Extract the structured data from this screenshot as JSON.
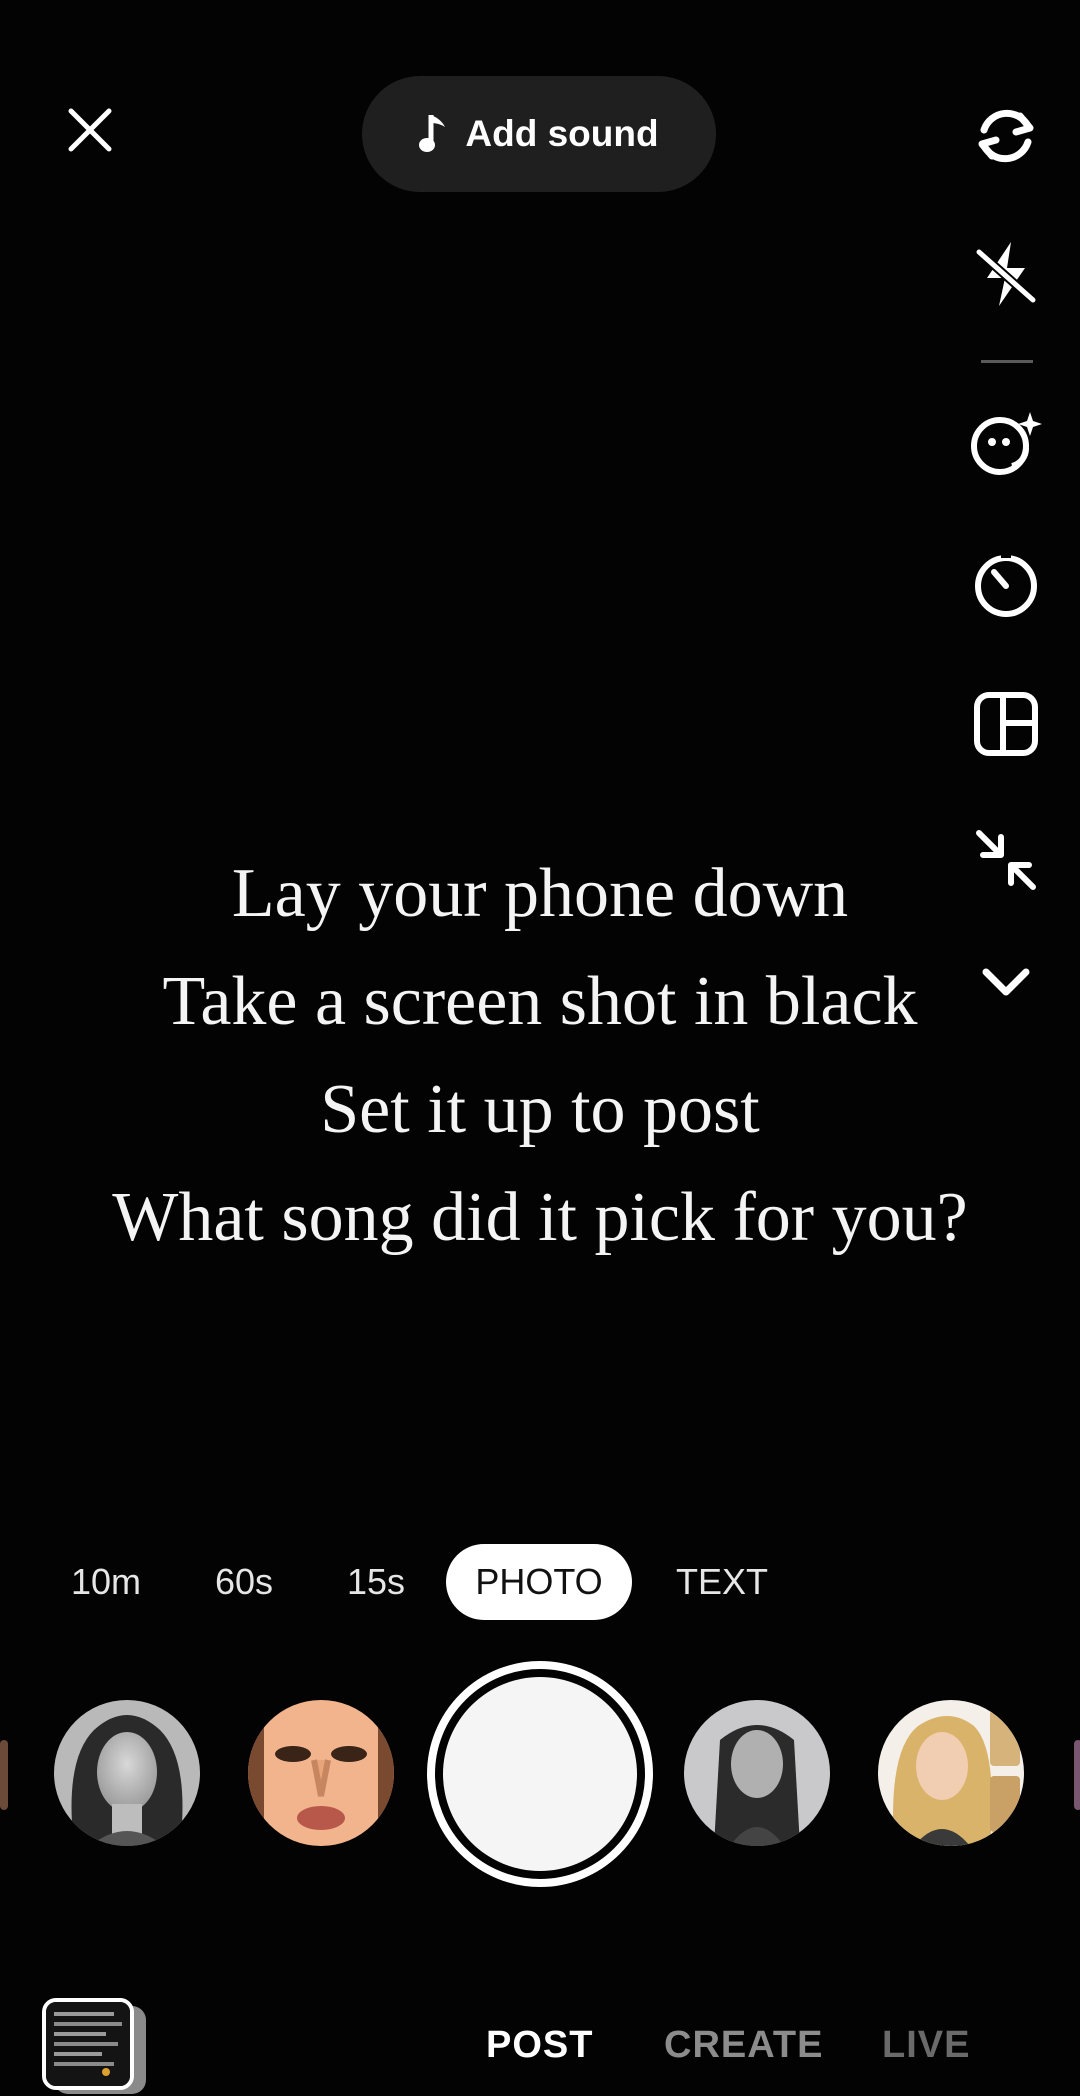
{
  "header": {
    "close_icon": "close-icon",
    "add_sound": {
      "icon": "music-note-icon",
      "label": "Add sound"
    }
  },
  "tools": [
    {
      "name": "flip-camera",
      "icon": "flip-camera-icon"
    },
    {
      "name": "flash",
      "icon": "flash-off-icon"
    },
    {
      "name": "effects",
      "icon": "face-sparkle-icon"
    },
    {
      "name": "timer",
      "icon": "timer-icon"
    },
    {
      "name": "layout",
      "icon": "layout-grid-icon"
    },
    {
      "name": "fit",
      "icon": "collapse-arrows-icon"
    },
    {
      "name": "more",
      "icon": "chevron-down-icon"
    }
  ],
  "overlay_text": {
    "line1": "Lay your phone down",
    "line2": "Take a screen shot in black",
    "line3": "Set it up to post",
    "line4": "What song did it pick for you?"
  },
  "modes": {
    "items": [
      "10m",
      "60s",
      "15s",
      "PHOTO",
      "TEXT"
    ],
    "selected": "PHOTO"
  },
  "effects_row": [
    {
      "name": "effect-portrait-1"
    },
    {
      "name": "effect-portrait-2"
    },
    {
      "name": "effect-portrait-3"
    },
    {
      "name": "effect-portrait-4"
    }
  ],
  "bottom_nav": {
    "post": "POST",
    "create": "CREATE",
    "live": "LIVE",
    "selected": "POST"
  },
  "colors": {
    "background": "#030303",
    "pill": "#1f1f1f",
    "text_primary": "#ffffff",
    "text_dim": "#8c8c8c",
    "text_dimmer": "#6a6a6a"
  }
}
